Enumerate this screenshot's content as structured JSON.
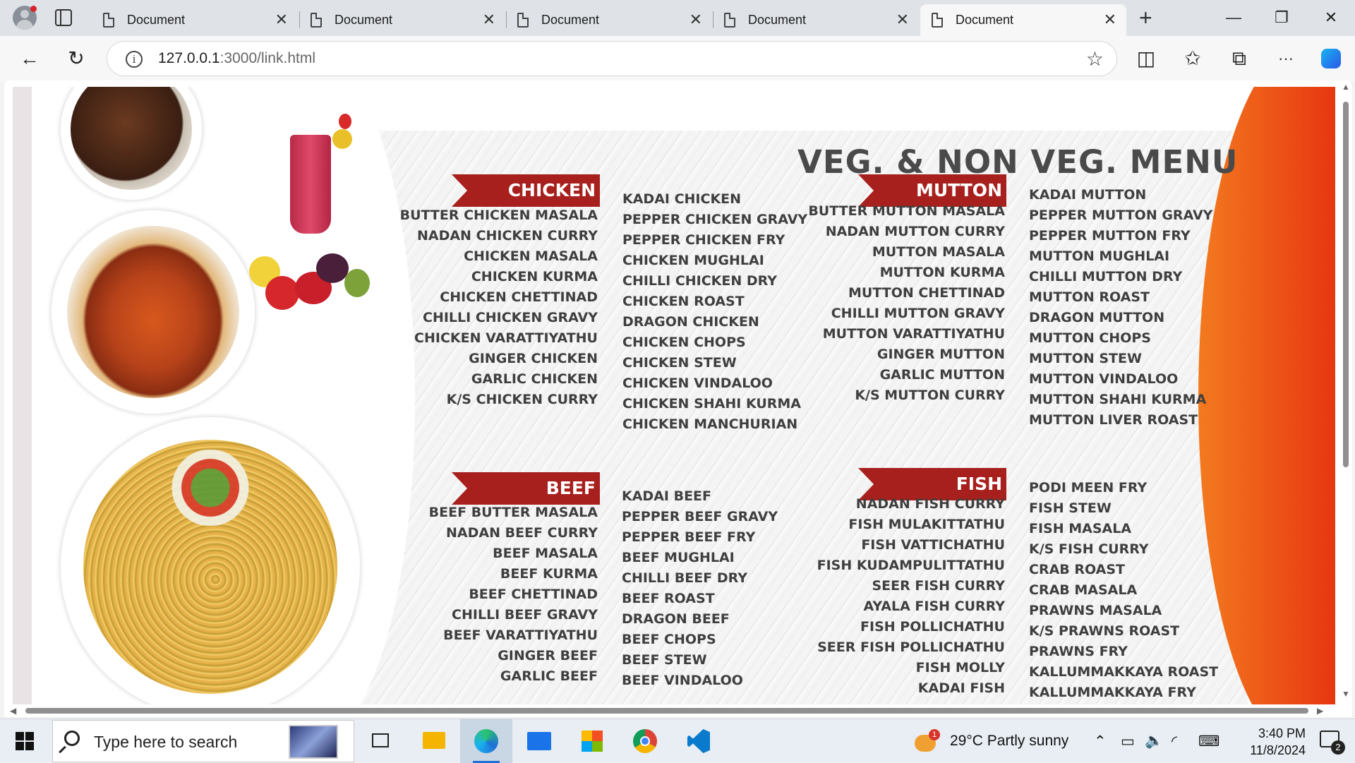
{
  "browser": {
    "tabs": [
      {
        "title": "Document",
        "active": false
      },
      {
        "title": "Document",
        "active": false
      },
      {
        "title": "Document",
        "active": false
      },
      {
        "title": "Document",
        "active": false
      },
      {
        "title": "Document",
        "active": true
      }
    ],
    "new_tab_icon": "+",
    "url_host": "127.0.0.1",
    "url_rest": ":3000/link.html",
    "icons": {
      "back": "←",
      "reload": "↻",
      "star": "☆",
      "split": "◫",
      "favorites": "✩",
      "collections": "⧉",
      "more": "···",
      "minimize": "—",
      "restore": "❐",
      "close": "✕",
      "tab_close": "✕"
    }
  },
  "menu": {
    "title": "VEG. & NON VEG. MENU",
    "chicken": {
      "heading": "CHICKEN",
      "left": [
        "BUTTER CHICKEN MASALA",
        "NADAN CHICKEN CURRY",
        "CHICKEN MASALA",
        "CHICKEN KURMA",
        "CHICKEN CHETTINAD",
        "CHILLI CHICKEN GRAVY",
        "CHICKEN VARATTIYATHU",
        "GINGER CHICKEN",
        "GARLIC CHICKEN",
        "K/S CHICKEN CURRY"
      ],
      "right": [
        "KADAI CHICKEN",
        "PEPPER CHICKEN GRAVY",
        "PEPPER CHICKEN FRY",
        "CHICKEN MUGHLAI",
        "CHILLI CHICKEN DRY",
        "CHICKEN ROAST",
        "DRAGON CHICKEN",
        "CHICKEN CHOPS",
        "CHICKEN STEW",
        "CHICKEN VINDALOO",
        "CHICKEN SHAHI KURMA",
        "CHICKEN MANCHURIAN"
      ]
    },
    "beef": {
      "heading": "BEEF",
      "left": [
        "BEEF BUTTER MASALA",
        "NADAN BEEF CURRY",
        "BEEF MASALA",
        "BEEF KURMA",
        "BEEF CHETTINAD",
        "CHILLI BEEF GRAVY",
        "BEEF VARATTIYATHU",
        "GINGER BEEF",
        "GARLIC BEEF"
      ],
      "right": [
        "KADAI BEEF",
        "PEPPER BEEF GRAVY",
        "PEPPER BEEF FRY",
        "BEEF MUGHLAI",
        "CHILLI BEEF DRY",
        "BEEF ROAST",
        "DRAGON BEEF",
        "BEEF CHOPS",
        "BEEF STEW",
        "BEEF VINDALOO"
      ]
    },
    "mutton": {
      "heading": "MUTTON",
      "left": [
        "BUTTER MUTTON MASALA",
        "NADAN MUTTON CURRY",
        "MUTTON MASALA",
        "MUTTON KURMA",
        "MUTTON CHETTINAD",
        "CHILLI MUTTON GRAVY",
        "MUTTON VARATTIYATHU",
        "GINGER MUTTON",
        "GARLIC MUTTON",
        "K/S MUTTON CURRY"
      ],
      "right": [
        "KADAI MUTTON",
        "PEPPER MUTTON GRAVY",
        "PEPPER MUTTON FRY",
        "MUTTON MUGHLAI",
        "CHILLI MUTTON DRY",
        "MUTTON ROAST",
        "DRAGON MUTTON",
        "MUTTON CHOPS",
        "MUTTON STEW",
        "MUTTON VINDALOO",
        "MUTTON SHAHI KURMA",
        "MUTTON LIVER ROAST"
      ]
    },
    "fish": {
      "heading": "FISH",
      "left": [
        "NADAN FISH CURRY",
        "FISH MULAKITTATHU",
        "FISH VATTICHATHU",
        "FISH KUDAMPULITTATHU",
        "SEER FISH CURRY",
        "AYALA FISH CURRY",
        "FISH POLLICHATHU",
        "SEER FISH POLLICHATHU",
        "FISH MOLLY",
        "KADAI FISH"
      ],
      "right": [
        "PODI MEEN FRY",
        "FISH STEW",
        "FISH MASALA",
        "K/S FISH CURRY",
        "CRAB ROAST",
        "CRAB MASALA",
        "PRAWNS MASALA",
        "K/S PRAWNS ROAST",
        "PRAWNS FRY",
        "KALLUMMAKKAYA ROAST",
        "KALLUMMAKKAYA FRY"
      ]
    }
  },
  "taskbar": {
    "search_placeholder": "Type here to search",
    "weather": "29°C  Partly sunny",
    "weather_badge": "1",
    "time": "3:40 PM",
    "date": "11/8/2024",
    "notification_count": "2",
    "colors": {
      "edge": "#1f6fd6",
      "explorer": "#f4b400",
      "mail": "#1a73e8",
      "chrome_red": "#db4437",
      "vscode": "#0a7acc"
    }
  },
  "brand_colors": {
    "ribbon": "#a8201d",
    "title": "#4a4a4a",
    "orange": "#e83b12"
  }
}
